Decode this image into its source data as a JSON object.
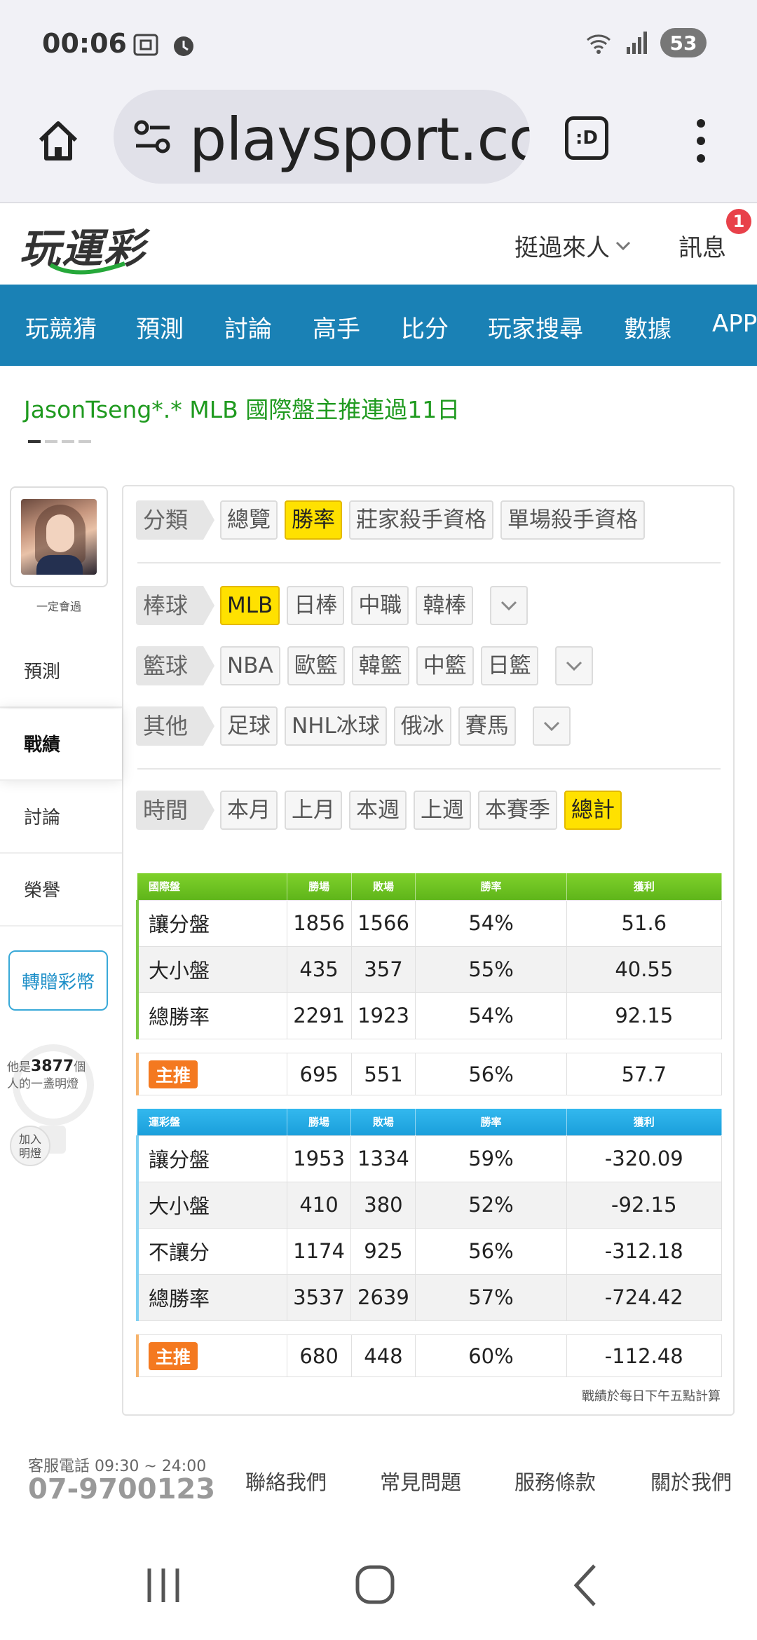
{
  "status": {
    "time": "00:06",
    "battery": "53"
  },
  "browser": {
    "url": "playsport.cc",
    "tab_label": ":D"
  },
  "site": {
    "logo": "玩運彩",
    "user_name": "挺過來人",
    "messages_label": "訊息",
    "messages_count": "1"
  },
  "nav": [
    "玩競猜",
    "預測",
    "討論",
    "高手",
    "比分",
    "玩家搜尋",
    "數據",
    "APP"
  ],
  "ticker": {
    "text": "JasonTseng*.* MLB 國際盤主推連過11日"
  },
  "sidebar": {
    "member_label": "一定會過",
    "items": [
      "預測",
      "戰績",
      "討論",
      "榮譽"
    ],
    "transfer_label": "轉贈彩幣",
    "lamp_prefix": "他是",
    "lamp_count": "3877",
    "lamp_suffix_1": "個",
    "lamp_suffix_2": "人的一盞明燈",
    "join_label_1": "加入",
    "join_label_2": "明燈"
  },
  "filters": {
    "category": {
      "label": "分類",
      "options": [
        "總覽",
        "勝率",
        "莊家殺手資格",
        "單場殺手資格"
      ],
      "selected": "勝率"
    },
    "baseball": {
      "label": "棒球",
      "options": [
        "MLB",
        "日棒",
        "中職",
        "韓棒"
      ],
      "selected": "MLB"
    },
    "basketball": {
      "label": "籃球",
      "options": [
        "NBA",
        "歐籃",
        "韓籃",
        "中籃",
        "日籃"
      ]
    },
    "other": {
      "label": "其他",
      "options": [
        "足球",
        "NHL冰球",
        "俄冰",
        "賽馬"
      ]
    },
    "time": {
      "label": "時間",
      "options": [
        "本月",
        "上月",
        "本週",
        "上週",
        "本賽季",
        "總計"
      ],
      "selected": "總計"
    }
  },
  "intl_table": {
    "headers": [
      "國際盤",
      "勝場",
      "敗場",
      "勝率",
      "獲利"
    ],
    "rows": [
      [
        "讓分盤",
        "1856",
        "1566",
        "54%",
        "51.6"
      ],
      [
        "大小盤",
        "435",
        "357",
        "55%",
        "40.55"
      ],
      [
        "總勝率",
        "2291",
        "1923",
        "54%",
        "92.15"
      ]
    ],
    "pick": {
      "label": "主推",
      "values": [
        "695",
        "551",
        "56%",
        "57.7"
      ]
    }
  },
  "local_table": {
    "headers": [
      "運彩盤",
      "勝場",
      "敗場",
      "勝率",
      "獲利"
    ],
    "rows": [
      [
        "讓分盤",
        "1953",
        "1334",
        "59%",
        "-320.09"
      ],
      [
        "大小盤",
        "410",
        "380",
        "52%",
        "-92.15"
      ],
      [
        "不讓分",
        "1174",
        "925",
        "56%",
        "-312.18"
      ],
      [
        "總勝率",
        "3537",
        "2639",
        "57%",
        "-724.42"
      ]
    ],
    "pick": {
      "label": "主推",
      "values": [
        "680",
        "448",
        "60%",
        "-112.48"
      ]
    }
  },
  "note": "戰績於每日下午五點計算",
  "footer": {
    "hotline_label": "客服電話 09:30 ~ 24:00",
    "hotline": "07-9700123",
    "links": [
      "聯絡我們",
      "常見問題",
      "服務條款",
      "關於我們"
    ]
  }
}
